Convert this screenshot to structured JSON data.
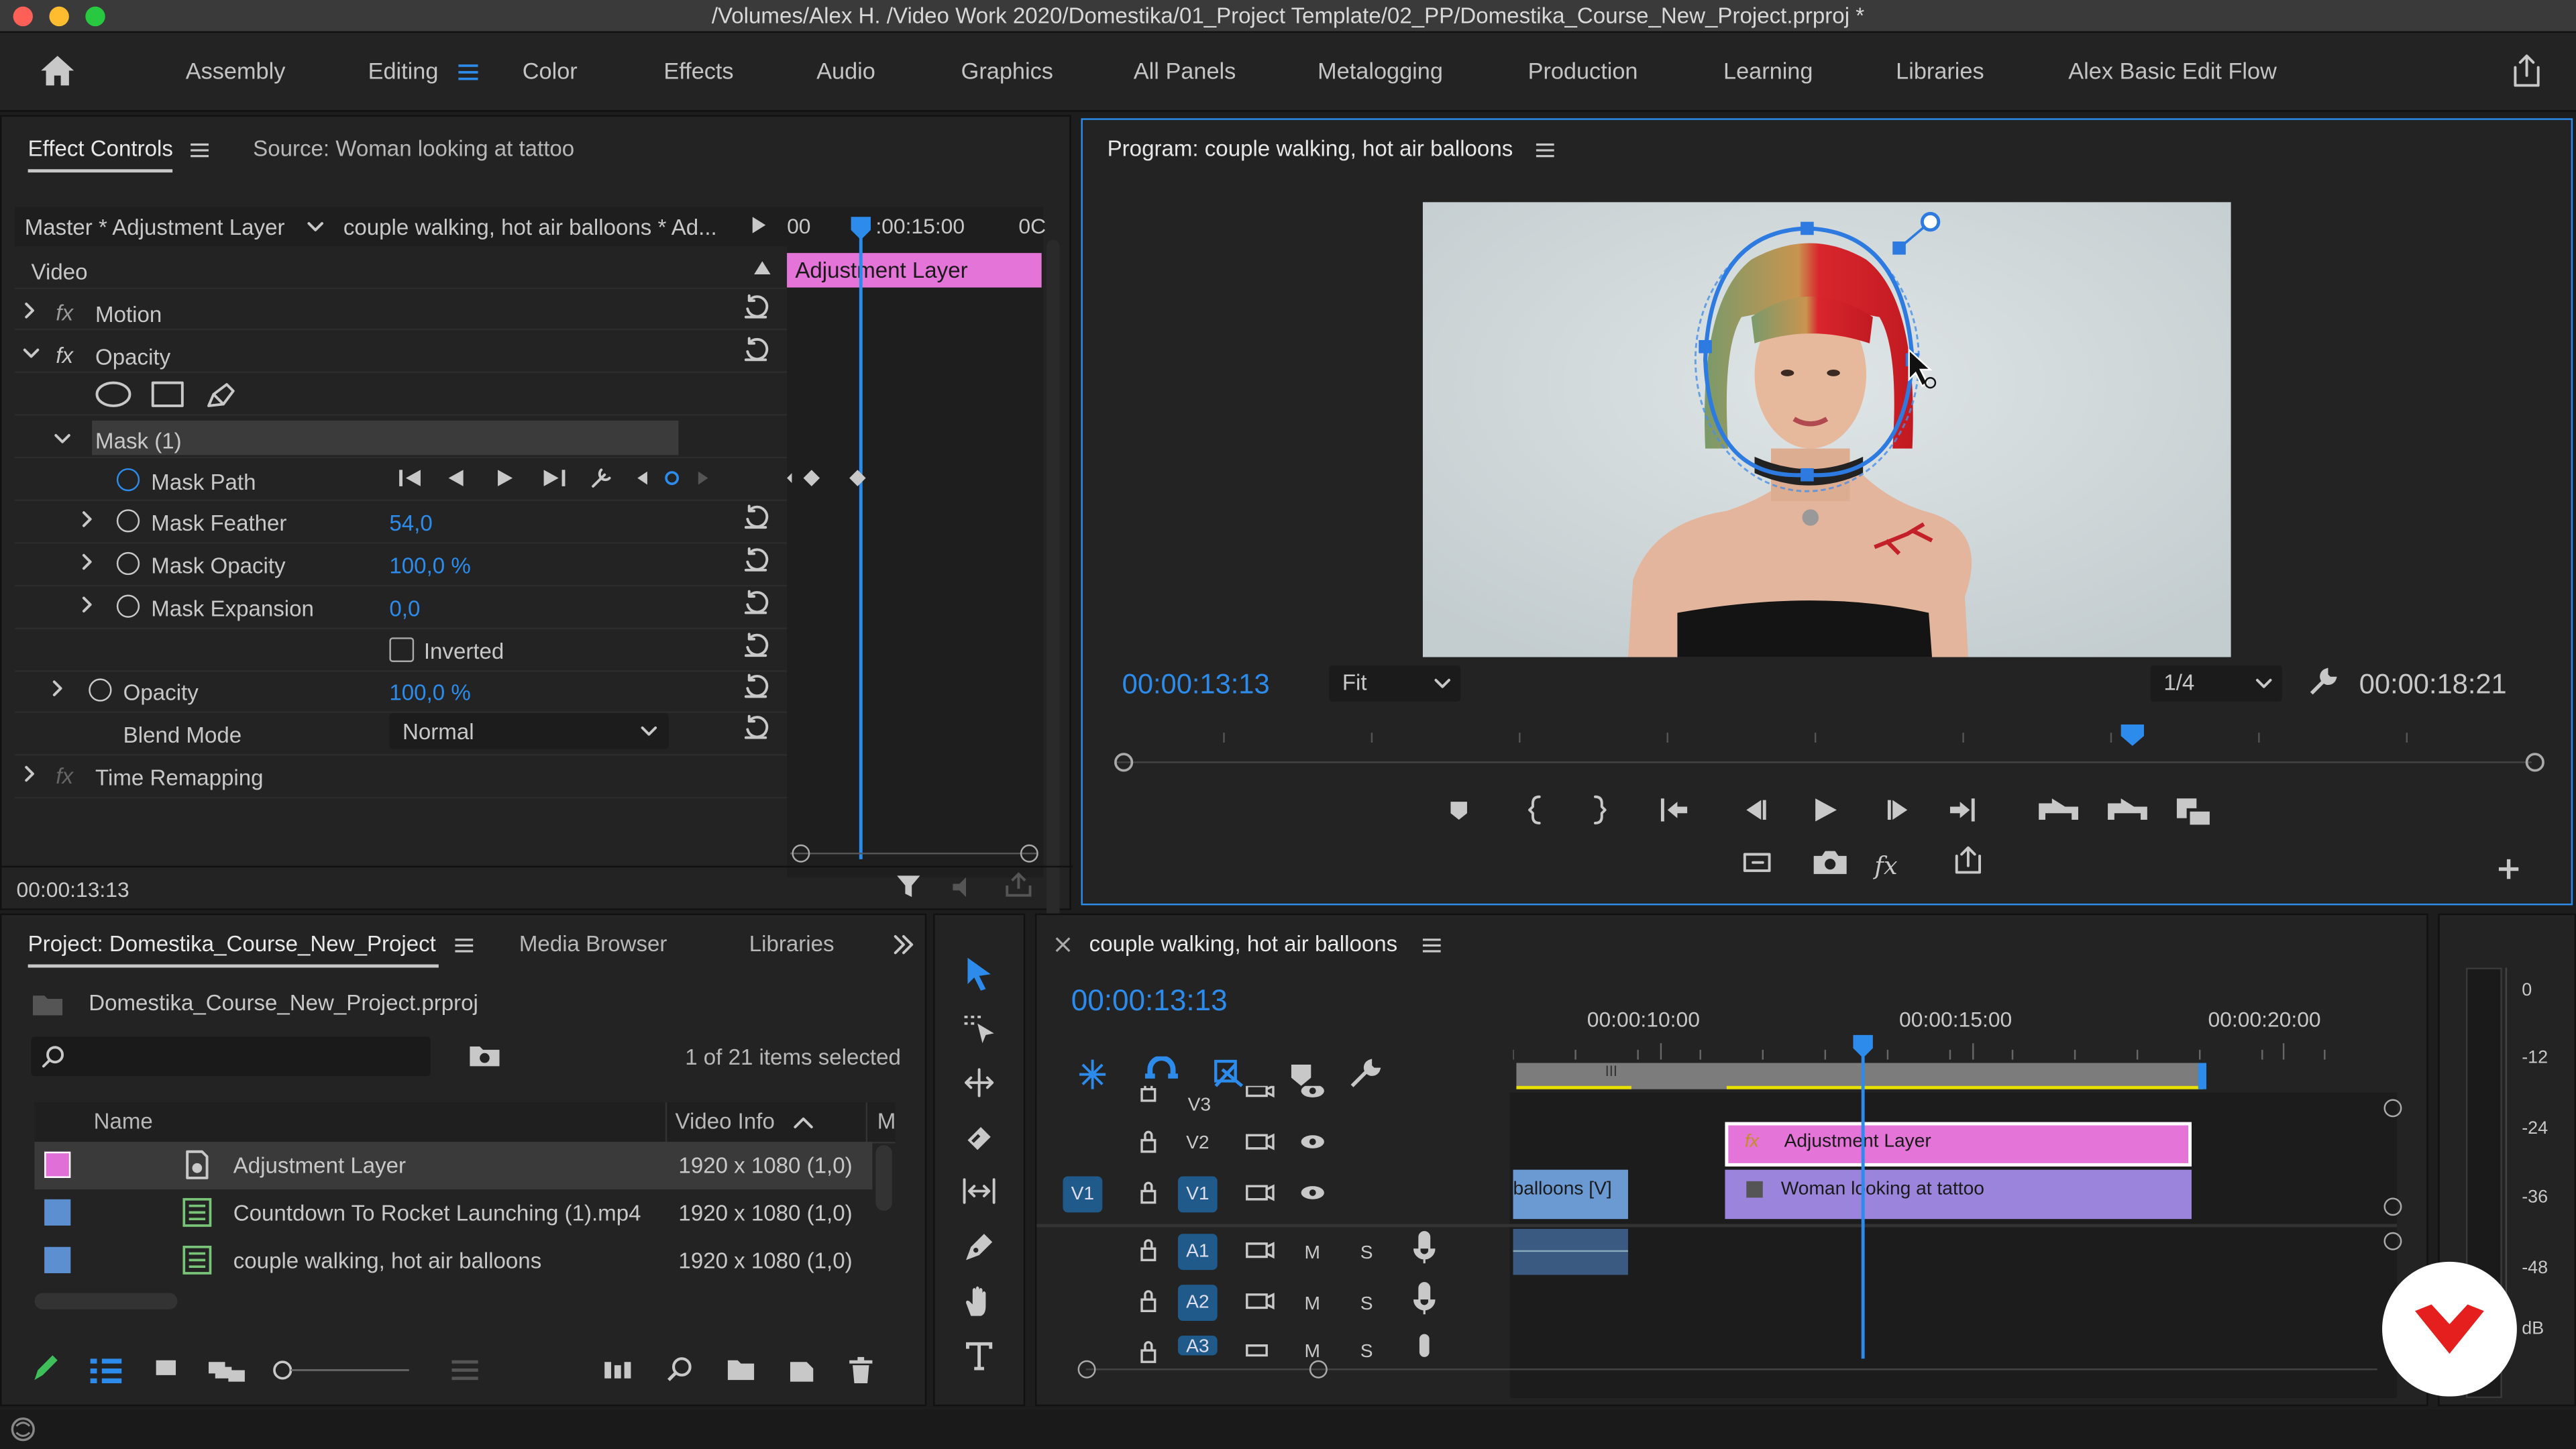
{
  "title": "/Volumes/Alex H. /Video Work 2020/Domestika/01_Project Template/02_PP/Domestika_Course_New_Project.prproj *",
  "workspaces": [
    "Assembly",
    "Editing",
    "Color",
    "Effects",
    "Audio",
    "Graphics",
    "All Panels",
    "Metalogging",
    "Production",
    "Learning",
    "Libraries",
    "Alex Basic Edit Flow"
  ],
  "active_workspace": "Editing",
  "effect_controls": {
    "tab": "Effect Controls",
    "source_tab": "Source: Woman looking at tattoo",
    "master": "Master * Adjustment Layer",
    "sequence": "couple walking, hot air balloons * Ad...",
    "ruler_left": "00",
    "ruler_mid": ":00:15:00",
    "ruler_right": "0C",
    "clip_label": "Adjustment Layer",
    "section": "Video",
    "motion": "Motion",
    "opacity": "Opacity",
    "mask": "Mask (1)",
    "mask_path": "Mask Path",
    "mask_feather": "Mask Feather",
    "mask_feather_val": "54,0",
    "mask_opacity": "Mask Opacity",
    "mask_opacity_val": "100,0 %",
    "mask_expansion": "Mask Expansion",
    "mask_expansion_val": "0,0",
    "inverted": "Inverted",
    "opacity2": "Opacity",
    "opacity_val": "100,0 %",
    "blend_mode": "Blend Mode",
    "blend_val": "Normal",
    "time_remap": "Time Remapping",
    "timecode": "00:00:13:13"
  },
  "program": {
    "tab": "Program: couple walking, hot air balloons",
    "timecode": "00:00:13:13",
    "fit": "Fit",
    "resolution": "1/4",
    "duration": "00:00:18:21"
  },
  "project": {
    "tab": "Project: Domestika_Course_New_Project",
    "tab2": "Media Browser",
    "tab3": "Libraries",
    "file": "Domestika_Course_New_Project.prproj",
    "selected": "1 of 21 items selected",
    "col_name": "Name",
    "col_video": "Video Info",
    "col_m": "M",
    "items": [
      {
        "name": "Adjustment Layer",
        "info": "1920 x 1080 (1,0)",
        "color": "#e070d8"
      },
      {
        "name": "Countdown To Rocket Launching (1).mp4",
        "info": "1920 x 1080 (1,0)",
        "color": "#5b8fd0"
      },
      {
        "name": "couple walking, hot air balloons",
        "info": "1920 x 1080 (1,0)",
        "color": "#5b8fd0"
      }
    ]
  },
  "timeline": {
    "tab": "couple walking, hot air balloons",
    "timecode": "00:00:13:13",
    "t1": "00:00:10:00",
    "t2": "00:00:15:00",
    "t3": "00:00:20:00",
    "tracks": [
      "V3",
      "V2",
      "V1",
      "A1",
      "A2",
      "A3"
    ],
    "src_v1": "V1",
    "m": "M",
    "s": "S",
    "clip_adj": "Adjustment Layer",
    "clip_woman": "Woman looking at tattoo",
    "clip_balloons": "balloons [V]"
  },
  "meter": {
    "l0": "0",
    "l1": "-12",
    "l2": "-24",
    "l3": "-36",
    "l4": "-48",
    "unit": "dB"
  }
}
